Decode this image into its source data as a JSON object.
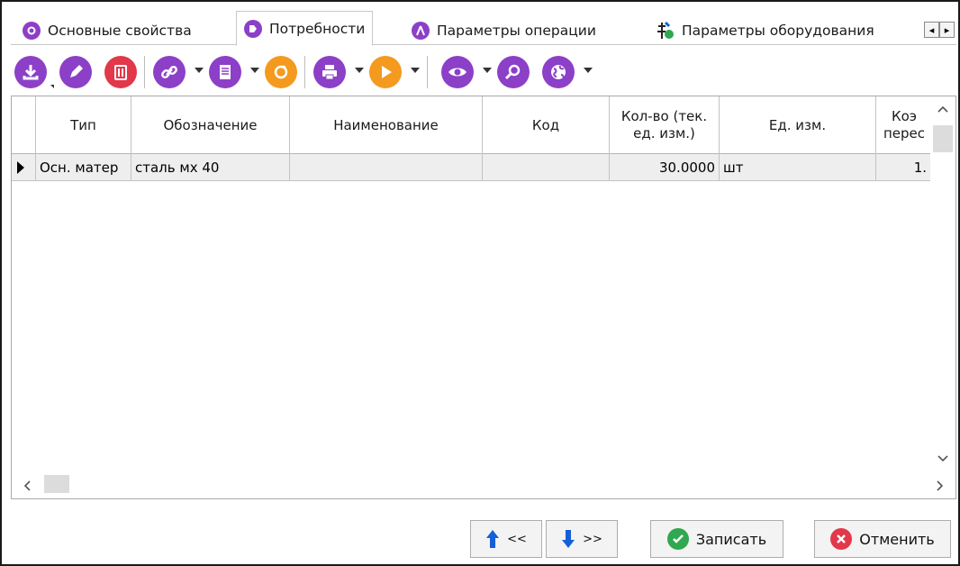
{
  "tabs": [
    {
      "label": "Основные свойства",
      "icon": "gear-icon"
    },
    {
      "label": "Потребности",
      "icon": "tag-icon",
      "active": true
    },
    {
      "label": "Параметры операции",
      "icon": "compass-icon"
    },
    {
      "label": "Параметры оборудования",
      "icon": "tools-icon"
    }
  ],
  "tab_scroll": {
    "left": "◂",
    "right": "▸"
  },
  "toolbar": {
    "icons": [
      "download-icon",
      "edit-icon",
      "delete-icon",
      "link-icon",
      "document-icon",
      "refresh-icon",
      "print-icon",
      "play-icon",
      "view-icon",
      "search-icon",
      "globe-icon"
    ]
  },
  "grid": {
    "columns": [
      "Тип",
      "Обозначение",
      "Наименование",
      "Код",
      "Кол-во (тек. ед. изм.)",
      "Ед. изм.",
      "Коэ перес"
    ],
    "rows": [
      {
        "type": "Осн. матер",
        "designation": "сталь мх 40",
        "name": "",
        "code": "",
        "qty": "30.0000",
        "unit": "шт",
        "coef": "1."
      }
    ]
  },
  "buttons": {
    "up_label": "<<",
    "down_label": ">>",
    "save_label": "Записать",
    "cancel_label": "Отменить"
  },
  "colors": {
    "accent": "#8c3fc7",
    "red": "#e2384a",
    "orange": "#f39a1f",
    "green": "#2fa84f",
    "blue": "#1560d8"
  }
}
